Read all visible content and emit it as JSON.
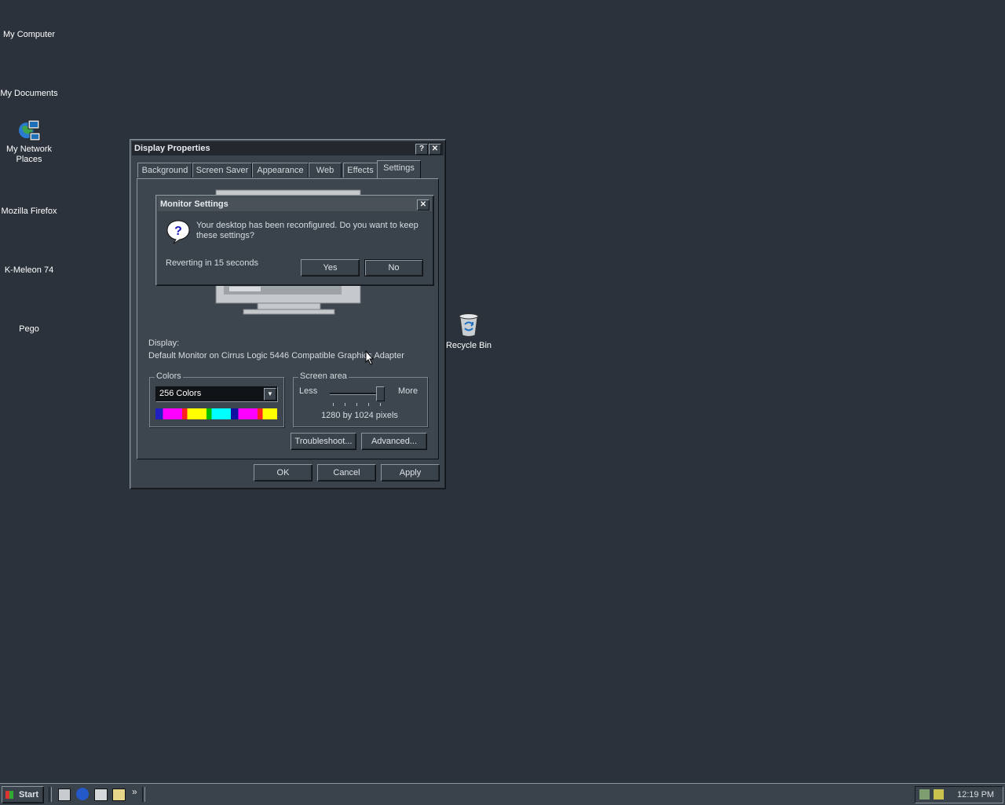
{
  "desktop": {
    "icons": [
      {
        "label": "My Computer",
        "icon": "computer-icon"
      },
      {
        "label": "My Documents",
        "icon": "folder-icon"
      },
      {
        "label": "My Network Places",
        "icon": "network-places-icon"
      },
      {
        "label": "Mozilla Firefox",
        "icon": "firefox-icon"
      },
      {
        "label": "K-Meleon 74",
        "icon": "kmeleon-icon"
      },
      {
        "label": "Pego",
        "icon": "pego-icon"
      },
      {
        "label": "Recycle Bin",
        "icon": "recycle-bin-icon"
      }
    ]
  },
  "display_properties": {
    "title": "Display Properties",
    "help_btn": "?",
    "close_btn": "✕",
    "tabs": [
      {
        "label": "Background"
      },
      {
        "label": "Screen Saver"
      },
      {
        "label": "Appearance"
      },
      {
        "label": "Web"
      },
      {
        "label": "Effects"
      },
      {
        "label": "Settings"
      }
    ],
    "selected_tab": "Settings",
    "display_label": "Display:",
    "display_value": "Default Monitor on Cirrus Logic 5446 Compatible Graphics Adapter",
    "colors_group": "Colors",
    "colors_value": "256 Colors",
    "screen_area_group": "Screen area",
    "less": "Less",
    "more": "More",
    "resolution": "1280 by 1024 pixels",
    "resolution_slider_fraction": 1.0,
    "troubleshoot": "Troubleshoot...",
    "advanced": "Advanced...",
    "ok": "OK",
    "cancel": "Cancel",
    "apply": "Apply"
  },
  "monitor_settings": {
    "title": "Monitor Settings",
    "close_btn": "✕",
    "message": "Your desktop has been reconfigured.  Do you want to keep these settings?",
    "countdown": "Reverting in 15 seconds",
    "yes": "Yes",
    "no": "No",
    "icon": "question-icon"
  },
  "taskbar": {
    "start": "Start",
    "overflow": "»",
    "clock": "12:19 PM"
  },
  "colors": {
    "desktop": "#2b323b",
    "window": "#3a424b",
    "titlebar": "#22282e"
  }
}
